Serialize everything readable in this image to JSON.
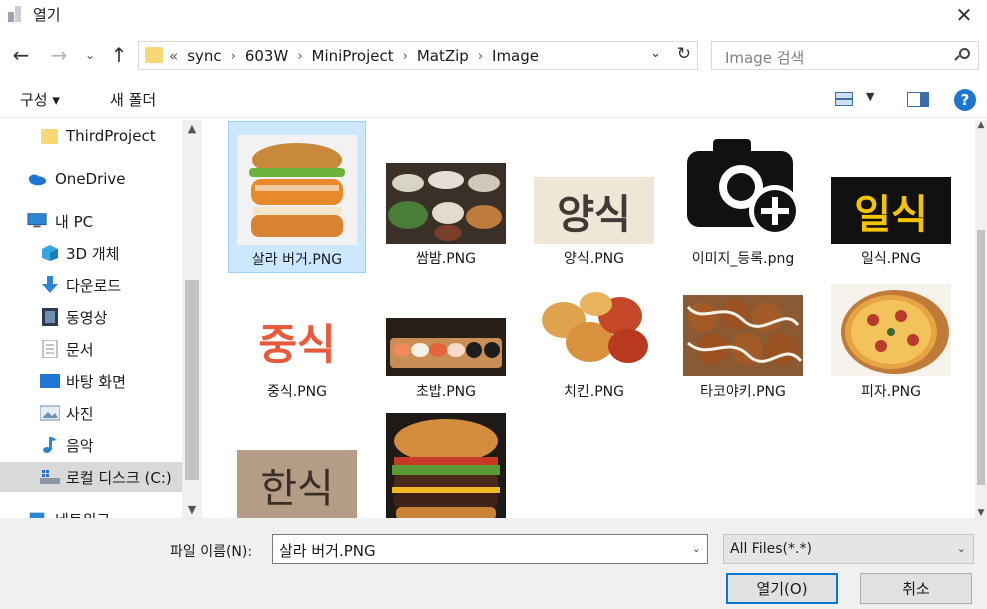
{
  "window": {
    "title": "열기",
    "close_glyph": "✕"
  },
  "nav": {
    "back_glyph": "←",
    "forward_glyph": "→",
    "recent_glyph": "⌄",
    "up_glyph": "↑"
  },
  "address": {
    "overflow": "«",
    "crumbs": [
      "sync",
      "603W",
      "MiniProject",
      "MatZip",
      "Image"
    ],
    "separator": "›",
    "dropdown_glyph": "⌄",
    "refresh_glyph": "↻"
  },
  "search": {
    "placeholder": "Image 검색"
  },
  "commands": {
    "organize": "구성 ▾",
    "new_folder": "새 폴더",
    "view_dropdown": "▼",
    "help": "?"
  },
  "sidebar": {
    "items": [
      {
        "label": "ThirdProject",
        "icon": "folder-icon"
      },
      {
        "label": "OneDrive",
        "icon": "onedrive-icon"
      },
      {
        "label": "내 PC",
        "icon": "pc-icon"
      },
      {
        "label": "3D 개체",
        "icon": "3d-objects-icon"
      },
      {
        "label": "다운로드",
        "icon": "download-icon"
      },
      {
        "label": "동영상",
        "icon": "video-icon"
      },
      {
        "label": "문서",
        "icon": "document-icon"
      },
      {
        "label": "바탕 화면",
        "icon": "desktop-icon"
      },
      {
        "label": "사진",
        "icon": "pictures-icon"
      },
      {
        "label": "음악",
        "icon": "music-icon"
      },
      {
        "label": "로컬 디스크 (C:)",
        "icon": "drive-icon"
      },
      {
        "label": "네트워크",
        "icon": "network-icon"
      }
    ],
    "scroll_up": "▲",
    "scroll_down": "▼"
  },
  "files": [
    {
      "name": "살라 버거.PNG",
      "thumb": "burger-chicken",
      "selected": true
    },
    {
      "name": "쌈밤.PNG",
      "thumb": "korean-table"
    },
    {
      "name": "양식.PNG",
      "thumb": "text-yangsik",
      "thumb_text": "양식"
    },
    {
      "name": "이미지_등록.png",
      "thumb": "camera-plus"
    },
    {
      "name": "일식.PNG",
      "thumb": "text-ilsik",
      "thumb_text": "일식"
    },
    {
      "name": "중식.PNG",
      "thumb": "text-jungsik",
      "thumb_text": "중식"
    },
    {
      "name": "초밥.PNG",
      "thumb": "sushi"
    },
    {
      "name": "치킨.PNG",
      "thumb": "chicken"
    },
    {
      "name": "타코야키.PNG",
      "thumb": "takoyaki"
    },
    {
      "name": "피자.PNG",
      "thumb": "pizza"
    },
    {
      "name": "",
      "thumb": "text-hansik",
      "thumb_text": "한식"
    },
    {
      "name": "",
      "thumb": "burger-beef"
    }
  ],
  "filename": {
    "label": "파일 이름(N):",
    "value": "살라 버거.PNG",
    "dropdown_glyph": "⌄"
  },
  "filetype": {
    "value": "All Files(*.*)",
    "dropdown_glyph": "⌄"
  },
  "buttons": {
    "open": "열기(O)",
    "cancel": "취소"
  },
  "colors": {
    "selection": "#cce8ff",
    "accent": "#0078d7",
    "help": "#1f76d2"
  }
}
